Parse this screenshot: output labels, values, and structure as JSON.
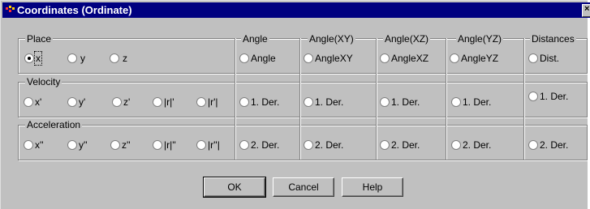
{
  "window": {
    "title": "Coordinates (Ordinate)"
  },
  "place": {
    "legend": "Place",
    "options": [
      {
        "label": "x",
        "checked": true
      },
      {
        "label": "y",
        "checked": false
      },
      {
        "label": "z",
        "checked": false
      }
    ]
  },
  "velocity": {
    "legend": "Velocity",
    "options": [
      {
        "label": "x'",
        "checked": false
      },
      {
        "label": "y'",
        "checked": false
      },
      {
        "label": "z'",
        "checked": false
      },
      {
        "label": "|r|'",
        "checked": false
      },
      {
        "label": "|r'|",
        "checked": false
      }
    ]
  },
  "acceleration": {
    "legend": "Acceleration",
    "options": [
      {
        "label": "x''",
        "checked": false
      },
      {
        "label": "y''",
        "checked": false
      },
      {
        "label": "z''",
        "checked": false
      },
      {
        "label": "|r|''",
        "checked": false
      },
      {
        "label": "|r''|",
        "checked": false
      }
    ]
  },
  "columns": [
    {
      "legend": "Angle",
      "place": "Angle",
      "velocity": "1. Der.",
      "acceleration": "2. Der."
    },
    {
      "legend": "Angle(XY)",
      "place": "AngleXY",
      "velocity": "1. Der.",
      "acceleration": "2. Der."
    },
    {
      "legend": "Angle(XZ)",
      "place": "AngleXZ",
      "velocity": "1. Der.",
      "acceleration": "2. Der."
    },
    {
      "legend": "Angle(YZ)",
      "place": "AngleYZ",
      "velocity": "1. Der.",
      "acceleration": "2. Der."
    },
    {
      "legend": "Distances",
      "place": "Dist.",
      "velocity": "1. Der.",
      "acceleration": "2. Der."
    }
  ],
  "buttons": {
    "ok": "OK",
    "cancel": "Cancel",
    "help": "Help"
  }
}
